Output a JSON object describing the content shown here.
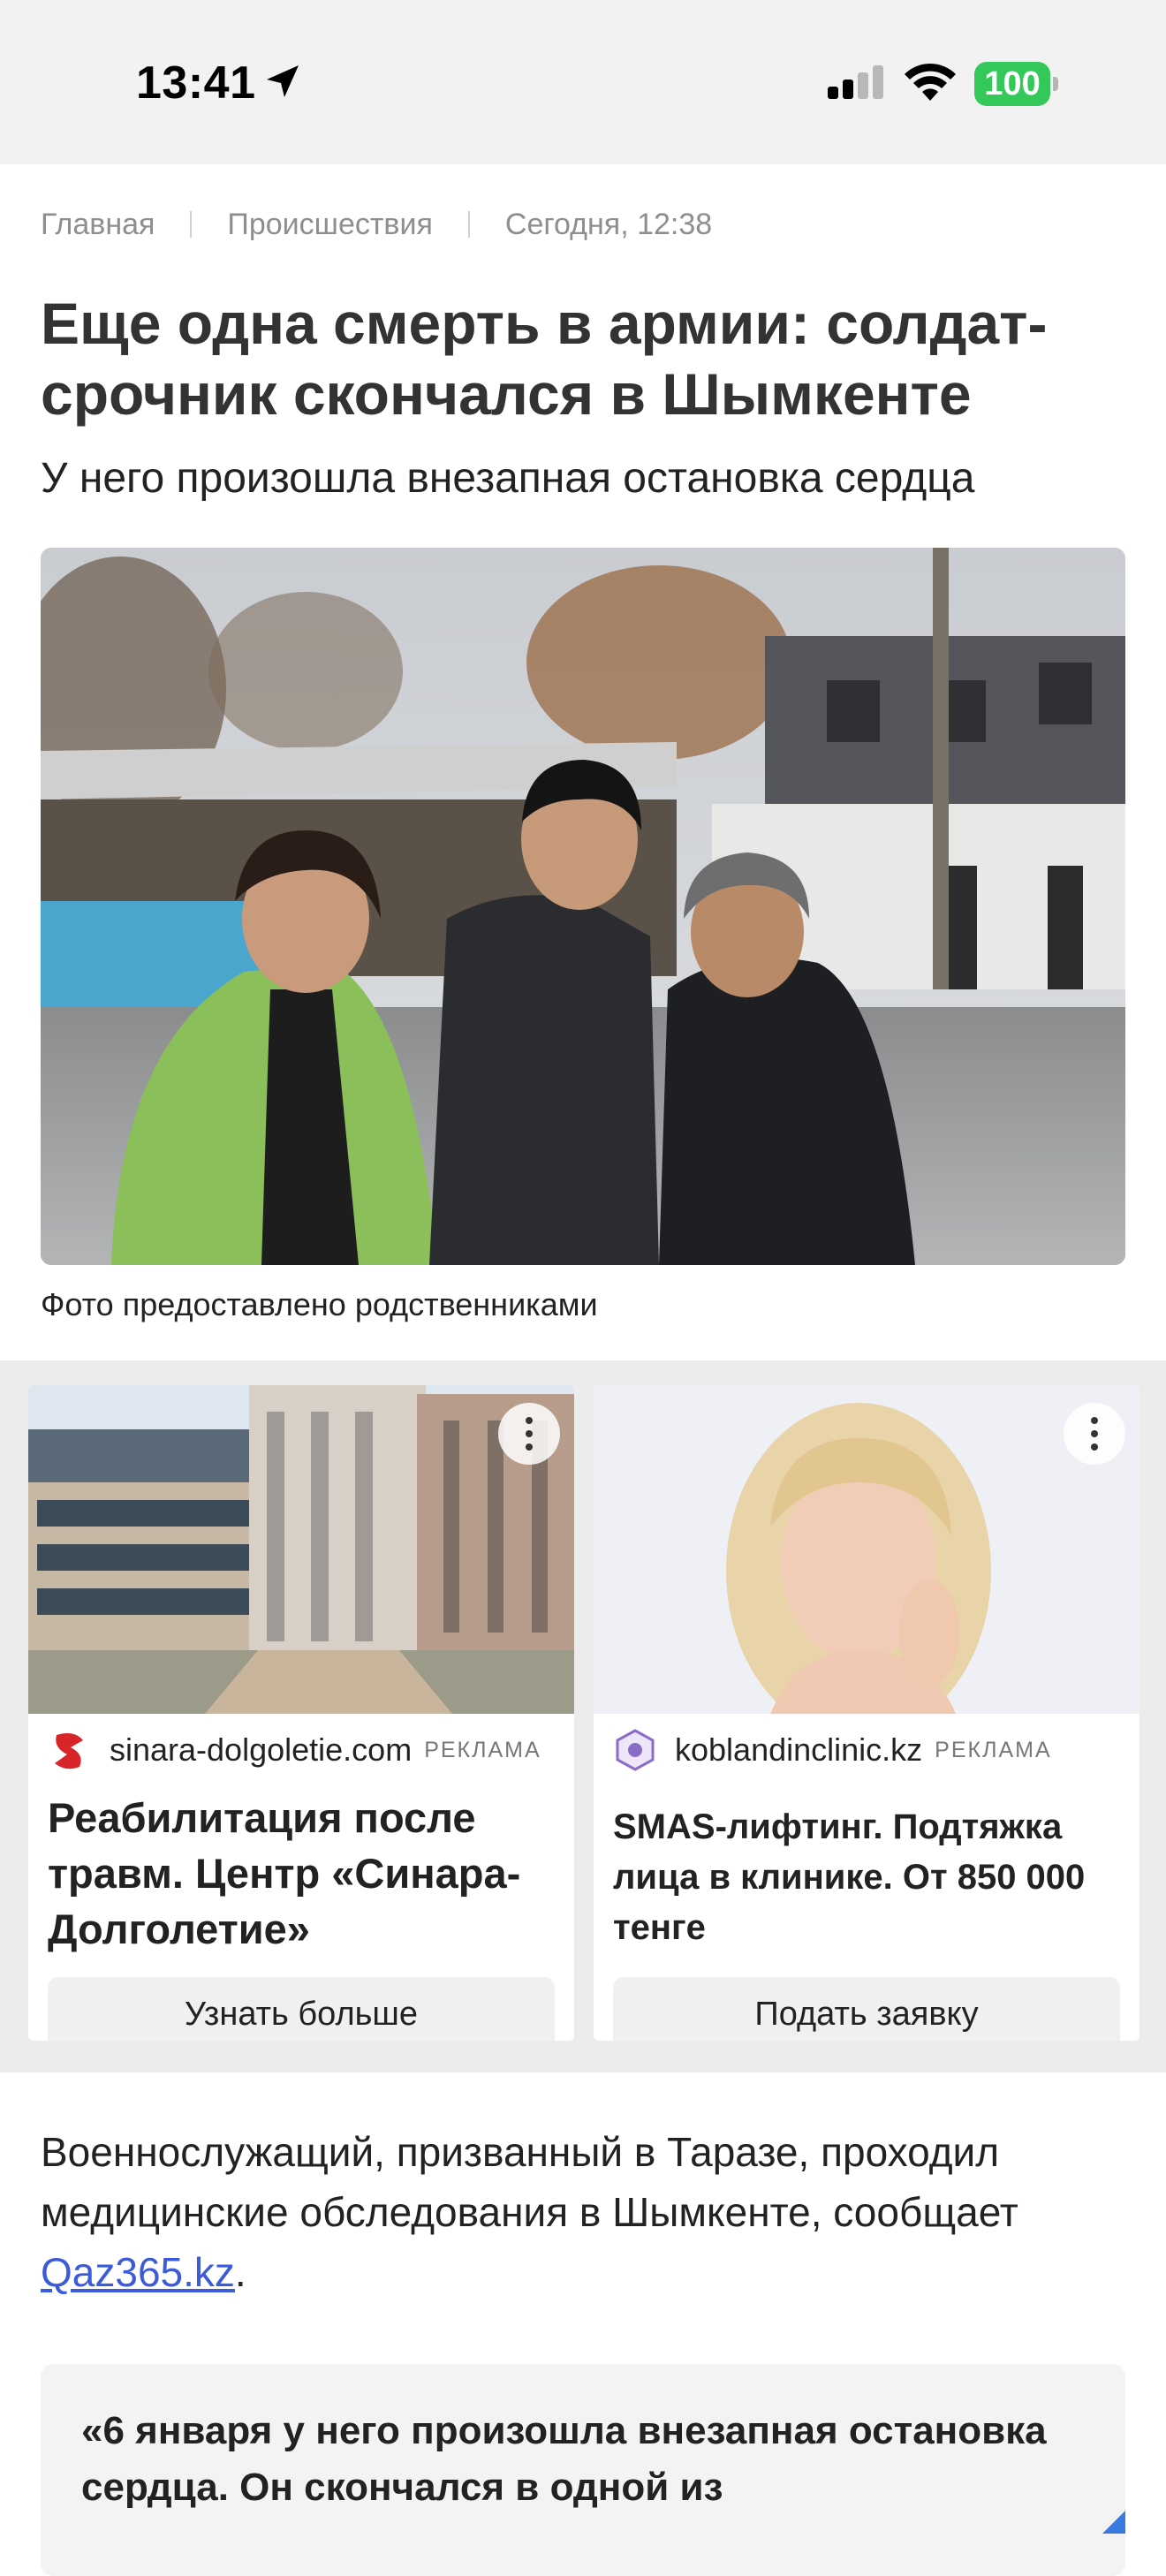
{
  "status_bar": {
    "time": "13:41",
    "battery": "100"
  },
  "breadcrumb": {
    "home": "Главная",
    "section": "Происшествия",
    "date": "Сегодня, 12:38"
  },
  "article": {
    "title": "Еще одна смерть в армии: солдат-срочник скончался в Шымкенте",
    "subtitle": "У него произошла внезапная остановка сердца",
    "photo_caption": "Фото предоставлено родственниками",
    "body_text": "Военнослужащий, призванный в Таразе, проходил медицинские обследования в Шымкенте, сообщает ",
    "body_link": "Qaz365.kz",
    "body_end": ".",
    "quote": "«6 января у него произошла внезапная остановка сердца. Он скончался в одной из"
  },
  "ads": [
    {
      "domain": "sinara-dolgoletie.com",
      "label": "РЕКЛАМА",
      "headline": "Реабилитация после травм. Центр «Синара-Долголетие»",
      "cta": "Узнать больше"
    },
    {
      "domain": "koblandinclinic.kz",
      "label": "РЕКЛАМА",
      "headline": "SMAS-лифтинг. Подтяжка лица в клинике. От 850 000 тенге",
      "cta": "Подать заявку"
    }
  ],
  "colors": {
    "accent_link": "#3b5bdb",
    "battery": "#34c759",
    "ad_background": "#ececec"
  }
}
